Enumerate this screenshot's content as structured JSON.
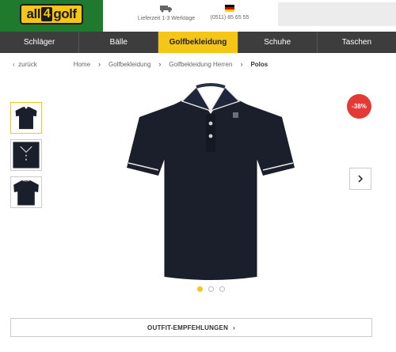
{
  "header": {
    "logo_pre": "all",
    "logo_num": "4",
    "logo_post": "golf",
    "delivery_text": "Lieferzeit 1-3 Werktage",
    "phone_text": "(0511) 85 65 55"
  },
  "nav": {
    "items": [
      "Schläger",
      "Bälle",
      "Golfbekleidung",
      "Schuhe",
      "Taschen"
    ],
    "active": "Golfbekleidung"
  },
  "breadcrumb": {
    "back": "zurück",
    "items": [
      "Home",
      "Golfbekleidung",
      "Golfbekleidung Herren",
      "Polos"
    ]
  },
  "product": {
    "discount": "-38%",
    "image_count": 3,
    "active_image": 1
  },
  "outfit_button": "OUTFIT-EMPFEHLUNGEN",
  "colors": {
    "brand_yellow": "#f5c518",
    "brand_green": "#1f7a2d",
    "nav_bg": "#3d3d3d",
    "badge_red": "#e53935"
  }
}
